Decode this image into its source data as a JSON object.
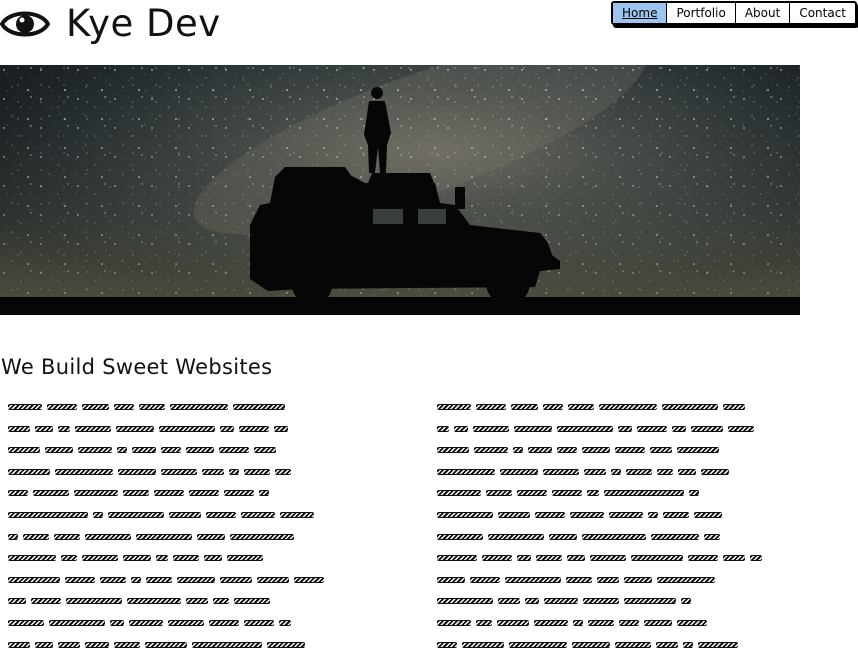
{
  "header": {
    "logo_icon": "eye-icon",
    "logo_text": "Kye Dev"
  },
  "nav": {
    "items": [
      {
        "label": "Home",
        "active": true
      },
      {
        "label": "Portfolio",
        "active": false
      },
      {
        "label": "About",
        "active": false
      },
      {
        "label": "Contact",
        "active": false
      }
    ],
    "active_color": "#9cc4ee"
  },
  "hero": {
    "image_description_icon": "night-sky-jeep-image"
  },
  "main": {
    "title": "We Build Sweet Websites"
  },
  "colors": {
    "text": "#111111",
    "background": "#ffffff",
    "nav_active": "#9cc4ee"
  }
}
